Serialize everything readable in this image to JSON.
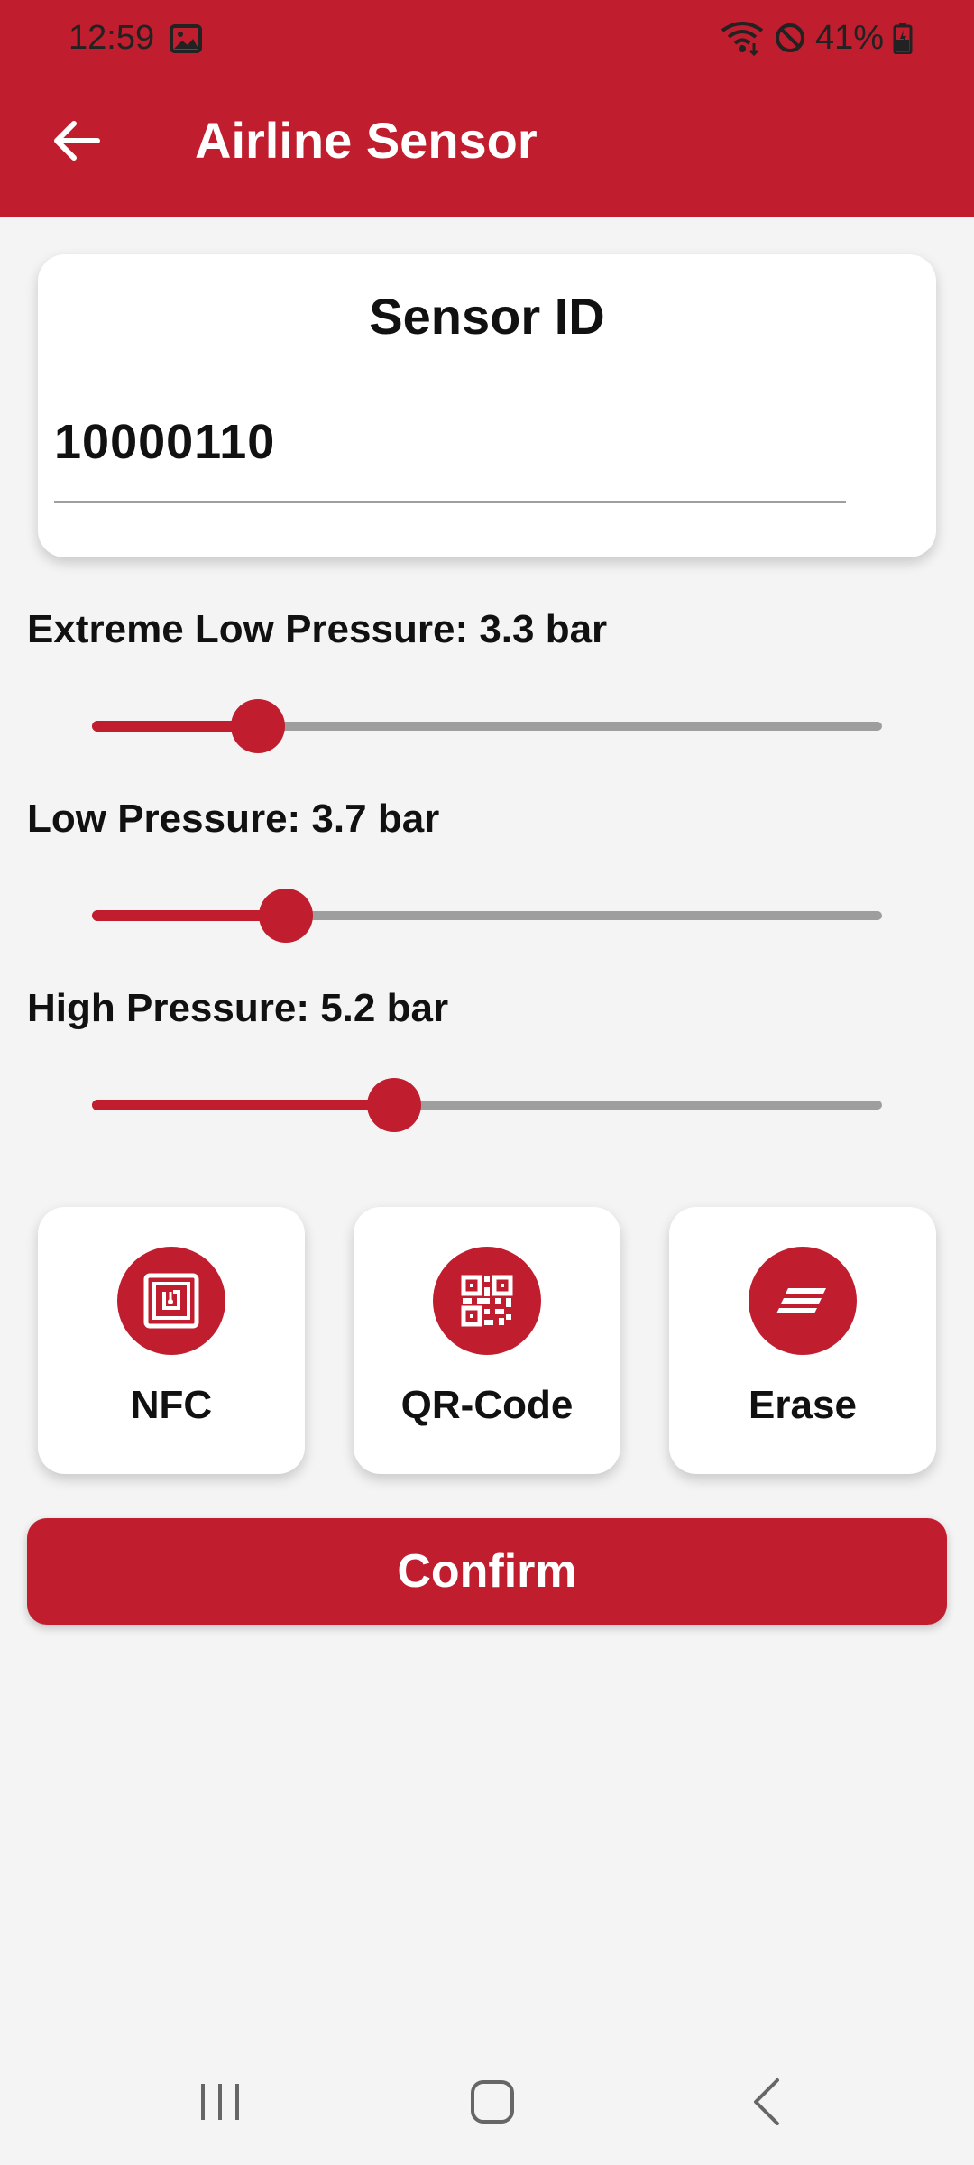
{
  "status_bar": {
    "time": "12:59",
    "battery": "41%",
    "icons": [
      "gallery-icon",
      "wifi-icon",
      "do-not-disturb-icon",
      "battery-charging-icon"
    ]
  },
  "app_bar": {
    "title": "Airline Sensor",
    "back_icon": "arrow-left-icon"
  },
  "sensor": {
    "title": "Sensor ID",
    "value": "10000110"
  },
  "sliders": [
    {
      "label": "Extreme Low Pressure: 3.3 bar",
      "fraction": 0.21
    },
    {
      "label": "Low Pressure: 3.7 bar",
      "fraction": 0.245
    },
    {
      "label": "High Pressure: 5.2 bar",
      "fraction": 0.382
    }
  ],
  "actions": [
    {
      "label": "NFC",
      "icon": "nfc-icon"
    },
    {
      "label": "QR-Code",
      "icon": "qr-code-icon"
    },
    {
      "label": "Erase",
      "icon": "erase-icon"
    }
  ],
  "confirm_label": "Confirm",
  "nav": [
    "recents-icon",
    "home-icon",
    "back-icon"
  ],
  "colors": {
    "primary": "#c01e2e",
    "background": "#f4f4f4",
    "track": "#9e9e9e"
  }
}
